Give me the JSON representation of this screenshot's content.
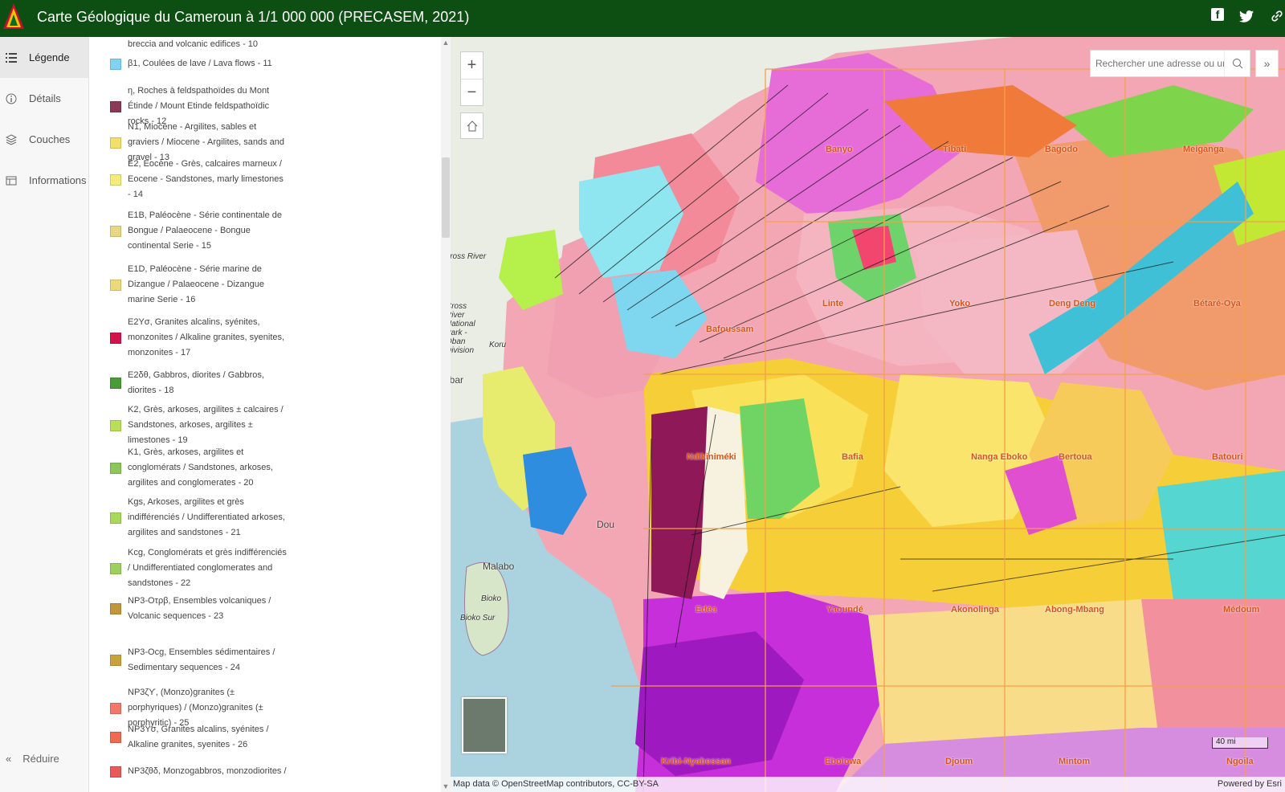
{
  "header": {
    "title": "Carte Géologique du Cameroun à 1/1 000 000 (PRECASEM, 2021)",
    "icons": [
      "logo-icon",
      "facebook-icon",
      "twitter-icon",
      "link-icon"
    ],
    "bg_color": "#0d4f12"
  },
  "nav": {
    "items": [
      {
        "label": "Légende",
        "icon": "legend-icon"
      },
      {
        "label": "Détails",
        "icon": "info-icon"
      },
      {
        "label": "Couches",
        "icon": "layers-icon"
      },
      {
        "label": "Informations",
        "icon": "table-icon"
      }
    ],
    "collapse_label": "Réduire"
  },
  "legend": {
    "items": [
      {
        "label": "breccia and volcanic edifices - 10",
        "color": ""
      },
      {
        "label": "β1, Coulées de lave / Lava flows - 11",
        "color": "#7fd4f5"
      },
      {
        "label": "η, Roches à feldspathoïdes du Mont Étinde / Mount Etinde feldspathoïdic rocks - 12",
        "color": "#8b3a55"
      },
      {
        "label": "N1, Miocène - Argilites, sables et graviers / Miocene - Argilites, sands and gravel - 13",
        "color": "#f2e06a"
      },
      {
        "label": "E2, Eocène - Grès, calcaires marneux / Eocene - Sandstones, marly limestones - 14",
        "color": "#f5eb78"
      },
      {
        "label": "E1B, Paléocène - Série continentale de Bongue / Palaeocene - Bongue continental Serie - 15",
        "color": "#e8d884"
      },
      {
        "label": "E1D, Paléocène - Série marine de Dizangue / Palaeocene - Dizangue marine Serie - 16",
        "color": "#ecd97a"
      },
      {
        "label": "E2Yσ, Granites alcalins, syénites, monzonites / Alkaline granites, syenites, monzonites - 17",
        "color": "#d3134b"
      },
      {
        "label": "E2δθ, Gabbros, diorites / Gabbros, diorites - 18",
        "color": "#4a9a3a"
      },
      {
        "label": "K2, Grès, arkoses, argilites ± calcaires / Sandstones, arkoses, argilites ± limestones - 19",
        "color": "#b9df5a"
      },
      {
        "label": "K1, Grès, arkoses, argilites et conglomérats / Sandstones, arkoses, argilites and conglomerates - 20",
        "color": "#8dc65a"
      },
      {
        "label": "Kgs, Arkoses, argilites et grès indifférenciés / Undifferentiated arkoses, argilites and sandstones - 21",
        "color": "#a8d85c"
      },
      {
        "label": "Kcg, Conglomérats et grès indifférenciés / Undifferentiated conglomerates and sandstones - 22",
        "color": "#9dd05c"
      },
      {
        "label": "NP3-Oτρβ, Ensembles volcaniques / Volcanic sequences - 23",
        "color": "#c2963a"
      },
      {
        "label": "NP3-Ocg, Ensembles sédimentaires / Sedimentary sequences - 24",
        "color": "#c8a23c"
      },
      {
        "label": "NP3ζϒ, (Monzo)granites (± porphyriques) / (Monzo)granites (± porphyritic) - 25",
        "color": "#f2786a"
      },
      {
        "label": "NP3Yσ, Granites alcalins, syénites / Alkaline granites, syenites - 26",
        "color": "#ee6a50"
      },
      {
        "label": "NP3ζθδ, Monzogabbros, monzodiorites /",
        "color": "#e85a5a"
      }
    ]
  },
  "map": {
    "search_placeholder": "Rechercher une adresse ou un",
    "attribution": "Map data © OpenStreetMap contributors, CC-BY-SA",
    "powered_by": "Powered by Esri",
    "scale_label": "40 mi",
    "places": [
      {
        "name": "Banyo"
      },
      {
        "name": "Tibati"
      },
      {
        "name": "Bagodo"
      },
      {
        "name": "Meiganga"
      },
      {
        "name": "Linte"
      },
      {
        "name": "Yoko"
      },
      {
        "name": "Deng Deng"
      },
      {
        "name": "Bétaré-Oya"
      },
      {
        "name": "Bafoussam"
      },
      {
        "name": "Ndikiniméki"
      },
      {
        "name": "Bafia"
      },
      {
        "name": "Nanga Eboko"
      },
      {
        "name": "Bertoua"
      },
      {
        "name": "Batouri"
      },
      {
        "name": "Edéa"
      },
      {
        "name": "Yaoundé"
      },
      {
        "name": "Akonolinga"
      },
      {
        "name": "Abong-Mbang"
      },
      {
        "name": "Médoum"
      },
      {
        "name": "Kribi-Nyabessan"
      },
      {
        "name": "Ebolowa"
      },
      {
        "name": "Djoum"
      },
      {
        "name": "Mintom"
      },
      {
        "name": "Ngoila"
      }
    ],
    "basemap_labels": [
      "Cross River",
      "Cross River National Park - Oban Division",
      "Malabo",
      "Bioko",
      "Bioko Sur",
      "abar",
      "Dou",
      "Koru"
    ]
  }
}
